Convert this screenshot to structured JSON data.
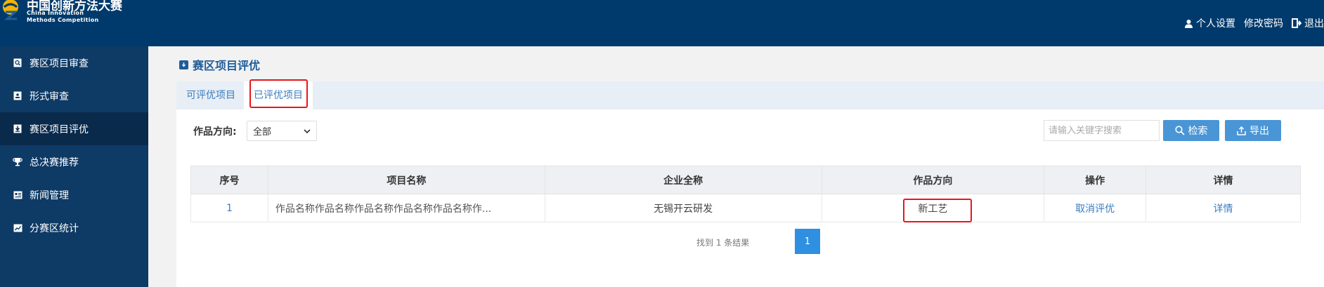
{
  "header": {
    "logo_cn": "中国创新方法大赛",
    "logo_en_line1": "China Innovation",
    "logo_en_line2": "Methods Competition",
    "links": [
      {
        "label": "个人设置",
        "icon": "user-icon"
      },
      {
        "label": "修改密码",
        "icon": "none"
      },
      {
        "label": "退出",
        "icon": "logout-icon"
      }
    ]
  },
  "sidebar": {
    "items": [
      {
        "label": "赛区项目审查",
        "icon": "search-doc-icon",
        "active": false
      },
      {
        "label": "形式审查",
        "icon": "id-card-icon",
        "active": false
      },
      {
        "label": "赛区项目评优",
        "icon": "download-icon",
        "active": true
      },
      {
        "label": "总决赛推荐",
        "icon": "trophy-icon",
        "active": false
      },
      {
        "label": "新闻管理",
        "icon": "news-icon",
        "active": false
      },
      {
        "label": "分赛区统计",
        "icon": "chart-icon",
        "active": false
      }
    ]
  },
  "main": {
    "page_title": "赛区项目评优",
    "tabs": [
      {
        "label": "可评优项目",
        "active": false
      },
      {
        "label": "已评优项目",
        "active": true
      }
    ],
    "filter": {
      "label": "作品方向:",
      "selected": "全部"
    },
    "search": {
      "placeholder": "请输入关键字搜索",
      "search_label": "检索",
      "export_label": "导出"
    },
    "table": {
      "columns": [
        "序号",
        "项目名称",
        "企业全称",
        "作品方向",
        "操作",
        "详情"
      ],
      "rows": [
        {
          "index": "1",
          "name": "作品名称作品名称作品名称作品名称作品名称作...",
          "company": "无锡开云研发",
          "direction": "新工艺",
          "action": "取消评优",
          "detail": "详情"
        }
      ]
    },
    "pagination": {
      "summary": "找到 1 条结果",
      "current_page": "1"
    }
  },
  "colors": {
    "header_bg": "#003a6c",
    "sidebar_bg": "#0e3a66",
    "sidebar_active_bg": "#0a2a4c",
    "accent": "#4a95d6",
    "highlight": "#e8161b"
  }
}
